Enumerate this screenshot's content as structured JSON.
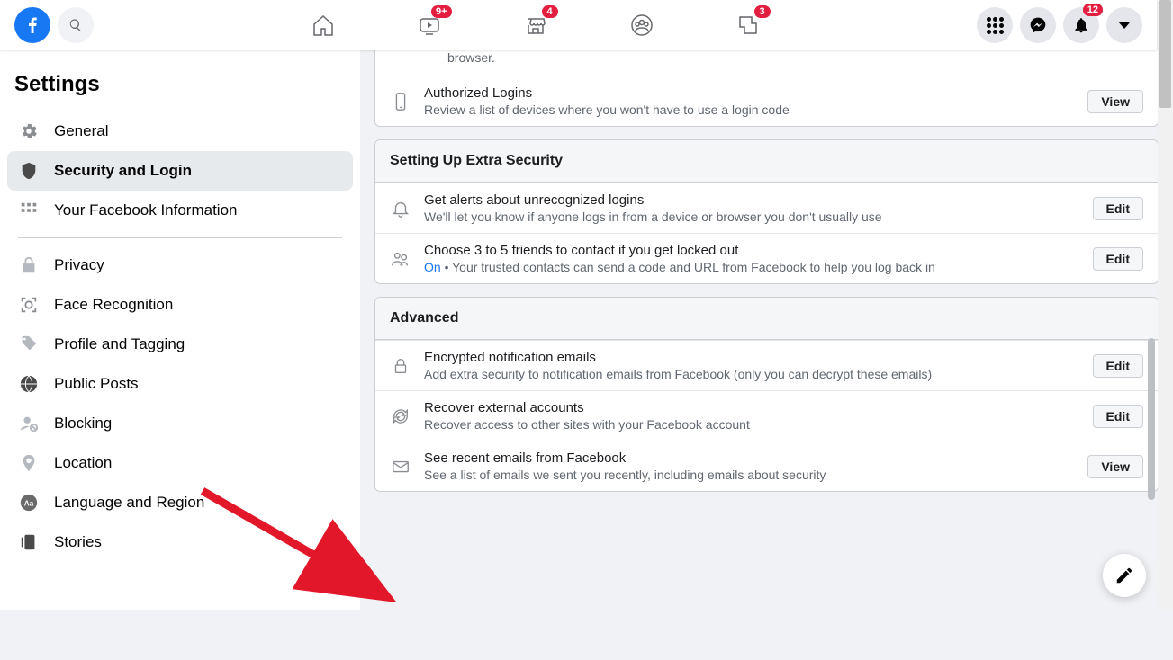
{
  "topbar": {
    "badges": {
      "watch": "9+",
      "market": "4",
      "gaming": "3",
      "notifications": "12"
    }
  },
  "sidebar": {
    "title": "Settings",
    "items": [
      {
        "label": "General"
      },
      {
        "label": "Security and Login"
      },
      {
        "label": "Your Facebook Information"
      },
      {
        "label": "Privacy"
      },
      {
        "label": "Face Recognition"
      },
      {
        "label": "Profile and Tagging"
      },
      {
        "label": "Public Posts"
      },
      {
        "label": "Blocking"
      },
      {
        "label": "Location"
      },
      {
        "label": "Language and Region"
      },
      {
        "label": "Stories"
      }
    ]
  },
  "partial": {
    "text": "browser.",
    "auth_logins": {
      "title": "Authorized Logins",
      "desc": "Review a list of devices where you won't have to use a login code",
      "action": "View"
    }
  },
  "extra_security": {
    "header": "Setting Up Extra Security",
    "alerts": {
      "title": "Get alerts about unrecognized logins",
      "desc": "We'll let you know if anyone logs in from a device or browser you don't usually use",
      "action": "Edit"
    },
    "friends": {
      "title": "Choose 3 to 5 friends to contact if you get locked out",
      "status": "On",
      "desc": " • Your trusted contacts can send a code and URL from Facebook to help you log back in",
      "action": "Edit"
    }
  },
  "advanced": {
    "header": "Advanced",
    "encrypted": {
      "title": "Encrypted notification emails",
      "desc": "Add extra security to notification emails from Facebook (only you can decrypt these emails)",
      "action": "Edit"
    },
    "recover": {
      "title": "Recover external accounts",
      "desc": "Recover access to other sites with your Facebook account",
      "action": "Edit"
    },
    "emails": {
      "title": "See recent emails from Facebook",
      "desc": "See a list of emails we sent you recently, including emails about security",
      "action": "View"
    }
  }
}
